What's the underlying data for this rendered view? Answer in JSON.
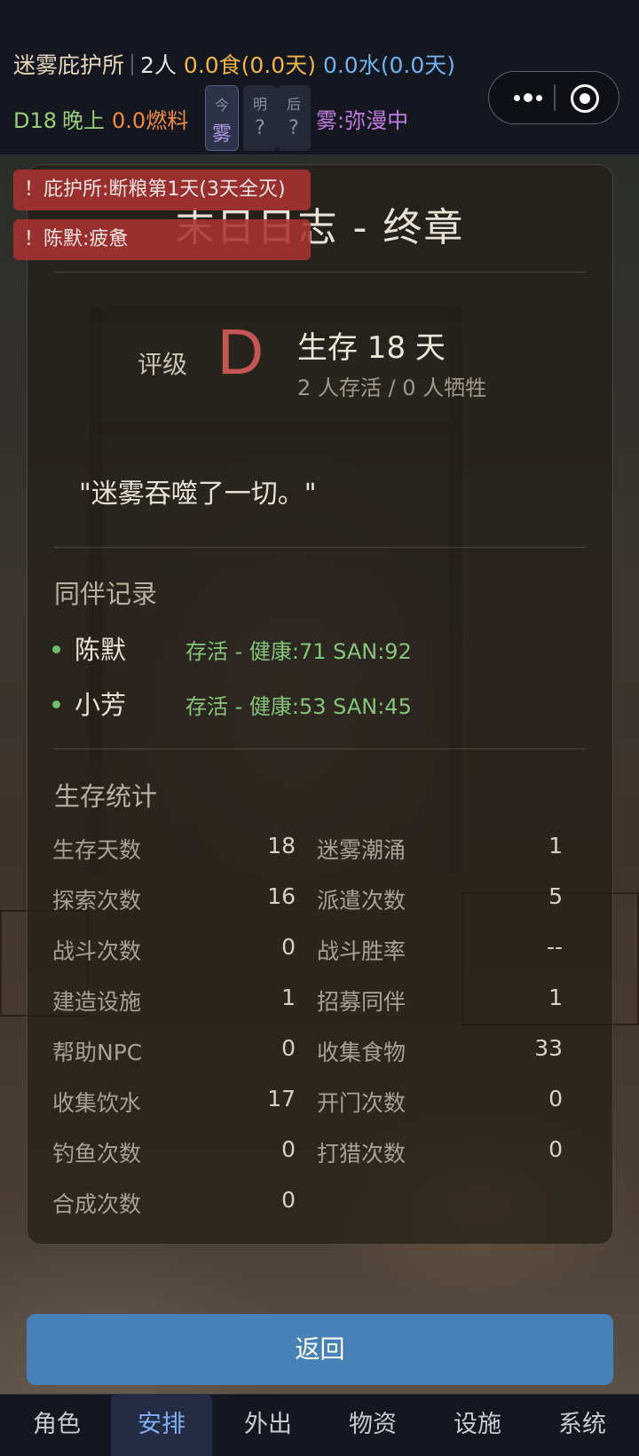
{
  "status": {
    "shelter": "迷雾庇护所",
    "people": "2人",
    "food": "0.0食(0.0天)",
    "water": "0.0水(0.0天)",
    "day": "D18",
    "time": "晚上",
    "fuel": "0.0燃料",
    "fog_forecast": [
      {
        "label": "今",
        "value": "雾"
      },
      {
        "label": "明",
        "value": "?"
      },
      {
        "label": "后",
        "value": "?"
      }
    ],
    "fog_state": "雾:弥漫中"
  },
  "alerts": [
    "！庇护所:断粮第1天(3天全灭)",
    "！陈默:疲惫"
  ],
  "panel": {
    "title": "末日日志 - 终章",
    "grade_label": "评级",
    "grade": "D",
    "days_text": "生存 18 天",
    "alive_text": "2 人存活 / 0 人牺牲",
    "quote": "\"迷雾吞噬了一切。\"",
    "companions_title": "同伴记录",
    "companions": [
      {
        "name": "陈默",
        "status": "存活 - 健康:71 SAN:92"
      },
      {
        "name": "小芳",
        "status": "存活 - 健康:53 SAN:45"
      }
    ],
    "stats_title": "生存统计",
    "stats": [
      {
        "label": "生存天数",
        "value": "18"
      },
      {
        "label": "迷雾潮涌",
        "value": "1"
      },
      {
        "label": "探索次数",
        "value": "16"
      },
      {
        "label": "派遣次数",
        "value": "5"
      },
      {
        "label": "战斗次数",
        "value": "0"
      },
      {
        "label": "战斗胜率",
        "value": "--"
      },
      {
        "label": "建造设施",
        "value": "1"
      },
      {
        "label": "招募同伴",
        "value": "1"
      },
      {
        "label": "帮助NPC",
        "value": "0"
      },
      {
        "label": "收集食物",
        "value": "33"
      },
      {
        "label": "收集饮水",
        "value": "17"
      },
      {
        "label": "开门次数",
        "value": "0"
      },
      {
        "label": "钓鱼次数",
        "value": "0"
      },
      {
        "label": "打猎次数",
        "value": "0"
      },
      {
        "label": "合成次数",
        "value": "0"
      }
    ]
  },
  "back_button": "返回",
  "tabs": [
    "角色",
    "安排",
    "外出",
    "物资",
    "设施",
    "系统"
  ],
  "active_tab": "安排"
}
